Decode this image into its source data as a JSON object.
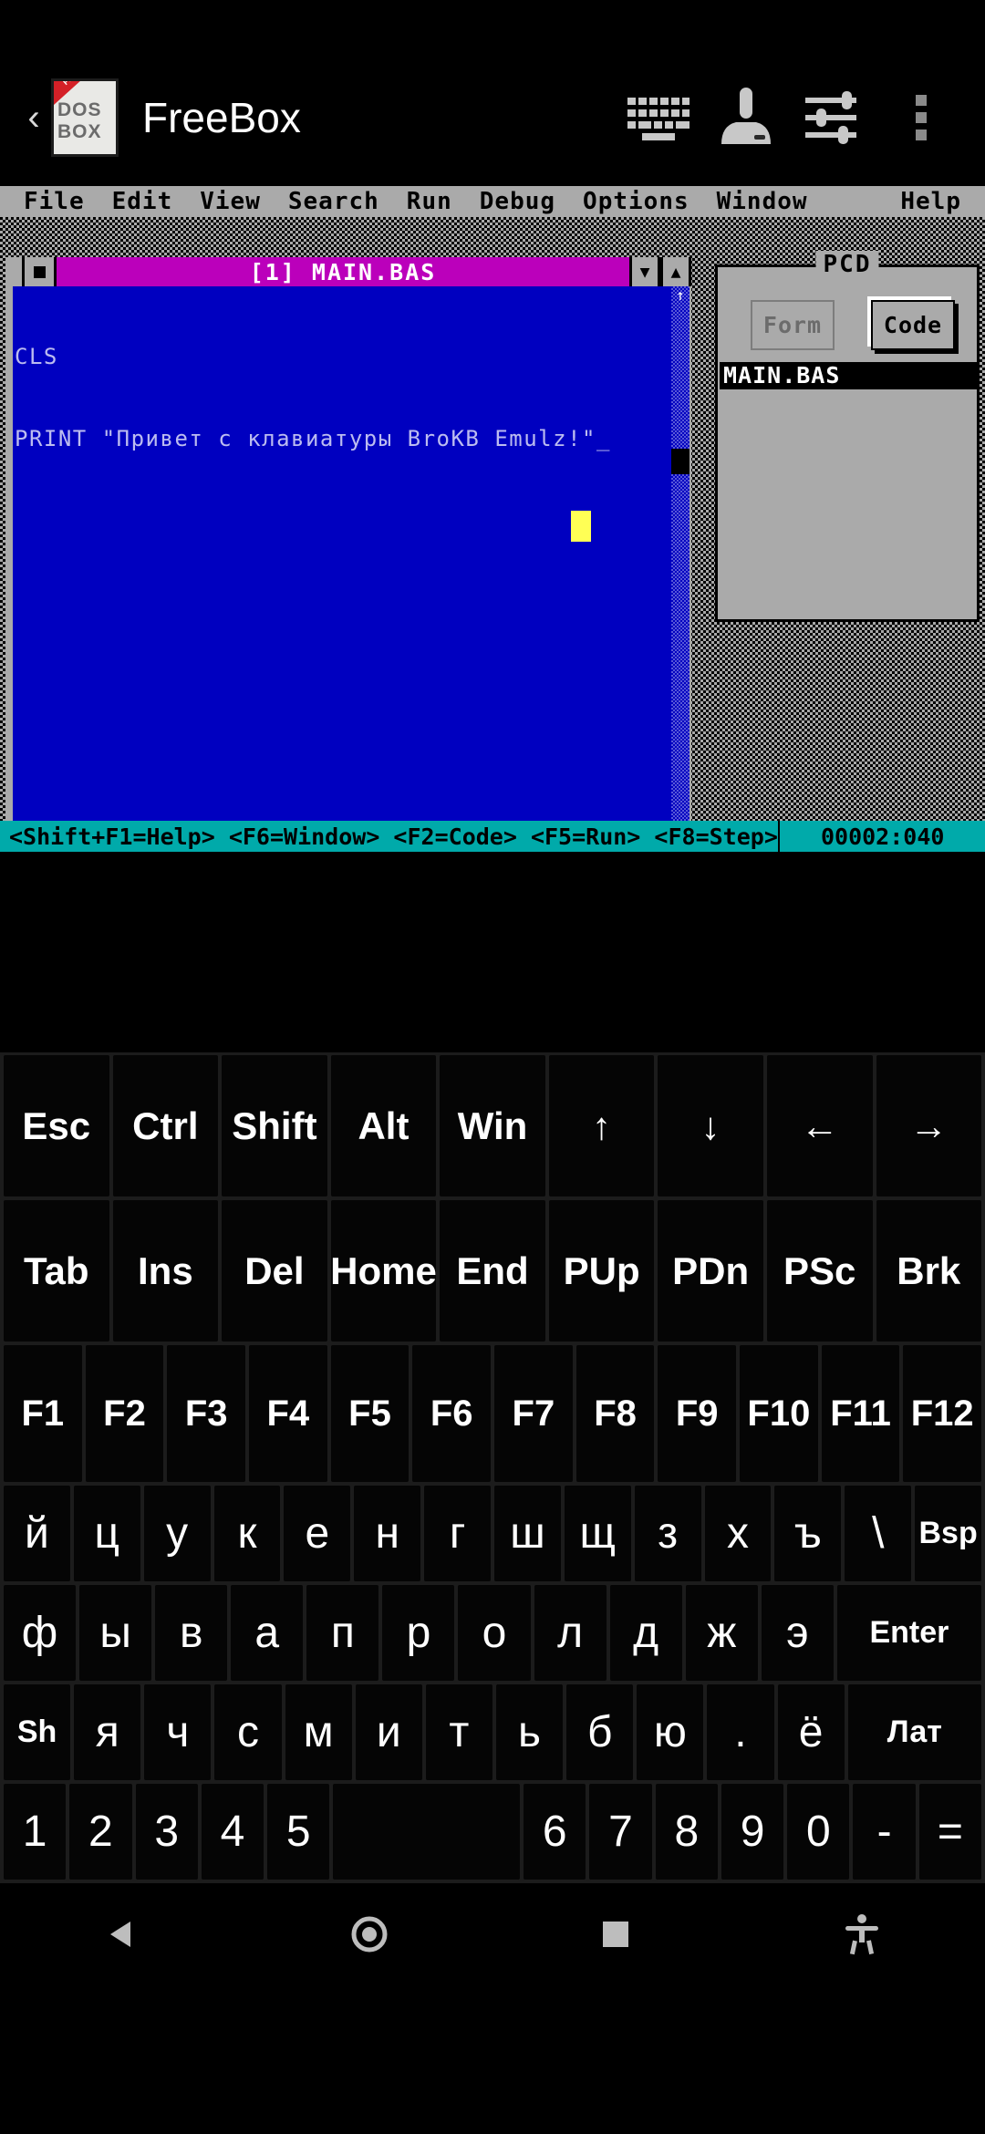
{
  "app": {
    "title": "FreeBox",
    "logo_top": "DOS",
    "logo_bottom": "BOX",
    "logo_ribbon": "FREE",
    "back_icon": "‹",
    "toolbar": [
      {
        "name": "keyboard-icon",
        "label": "keyboard"
      },
      {
        "name": "joystick-icon",
        "label": "joystick"
      },
      {
        "name": "sliders-icon",
        "label": "settings-sliders"
      },
      {
        "name": "overflow-menu-icon",
        "label": "more-options"
      }
    ]
  },
  "dos": {
    "menu": [
      "File",
      "Edit",
      "View",
      "Search",
      "Run",
      "Debug",
      "Options",
      "Window"
    ],
    "menu_help": "Help",
    "editor": {
      "title": "[1] MAIN.BAS",
      "close_label": "■",
      "btn_down": "▼",
      "btn_up": "▲",
      "code": [
        "CLS",
        "PRINT \"Привет с клавиатуры BroKB Emulz!\"_"
      ],
      "scroll_up": "↑",
      "scroll_down": "↓",
      "scroll_left": "←",
      "scroll_right": "→"
    },
    "pcd": {
      "legend": "PCD",
      "form_label": "Form",
      "code_label": "Code",
      "files": [
        "MAIN.BAS"
      ]
    },
    "status": {
      "hints": "<Shift+F1=Help> <F6=Window> <F2=Code> <F5=Run> <F8=Step>",
      "coords": "00002:040"
    },
    "colors": {
      "menubar_bg": "#aaaaaa",
      "title_bg": "#bb00bb",
      "editor_bg": "#0000c0",
      "editor_fg": "#bcbcf0",
      "status_bg": "#00aaaa",
      "cursor": "#ffff55"
    }
  },
  "keyboard": {
    "rows": [
      {
        "id": "row-fn",
        "keys": [
          "Esc",
          "Ctrl",
          "Shift",
          "Alt",
          "Win",
          "↑",
          "↓",
          "←",
          "→"
        ]
      },
      {
        "id": "row-nav",
        "keys": [
          "Tab",
          "Ins",
          "Del",
          "Home",
          "End",
          "PUp",
          "PDn",
          "PSc",
          "Brk"
        ]
      },
      {
        "id": "row-f",
        "keys": [
          "F1",
          "F2",
          "F3",
          "F4",
          "F5",
          "F6",
          "F7",
          "F8",
          "F9",
          "F10",
          "F11",
          "F12"
        ]
      },
      {
        "id": "row-q",
        "keys": [
          "й",
          "ц",
          "у",
          "к",
          "е",
          "н",
          "г",
          "ш",
          "щ",
          "з",
          "х",
          "ъ",
          "\\",
          "Bsp"
        ]
      },
      {
        "id": "row-a",
        "keys": [
          "ф",
          "ы",
          "в",
          "а",
          "п",
          "р",
          "о",
          "л",
          "д",
          "ж",
          "э",
          "Enter"
        ]
      },
      {
        "id": "row-z",
        "keys": [
          "Sh",
          "я",
          "ч",
          "с",
          "м",
          "и",
          "т",
          "ь",
          "б",
          "ю",
          ".",
          "ё",
          "Лат"
        ]
      },
      {
        "id": "row-n",
        "keys": [
          "1",
          "2",
          "3",
          "4",
          "5",
          "",
          "6",
          "7",
          "8",
          "9",
          "0",
          "-",
          "="
        ]
      }
    ]
  },
  "navbar": {
    "items": [
      {
        "name": "nav-back-icon",
        "label": "back"
      },
      {
        "name": "nav-home-icon",
        "label": "home"
      },
      {
        "name": "nav-recents-icon",
        "label": "recents"
      },
      {
        "name": "nav-accessibility-icon",
        "label": "accessibility"
      }
    ]
  }
}
